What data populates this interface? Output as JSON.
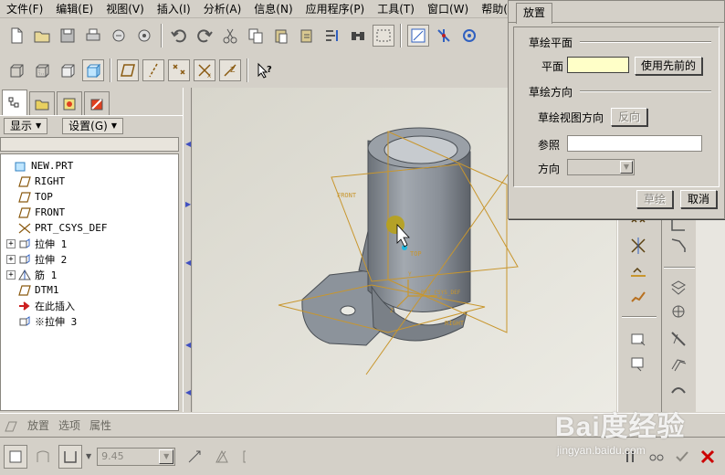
{
  "menubar": {
    "items": [
      "文件(F)",
      "编辑(E)",
      "视图(V)",
      "插入(I)",
      "分析(A)",
      "信息(N)",
      "应用程序(P)",
      "工具(T)",
      "窗口(W)",
      "帮助(H)"
    ]
  },
  "left_panel": {
    "show_label": "显示",
    "settings_label": "设置(G)"
  },
  "model_tree": {
    "items": [
      {
        "label": "NEW.PRT",
        "icon": "part-icon",
        "expand": ""
      },
      {
        "label": "RIGHT",
        "icon": "datum-plane-icon",
        "expand": ""
      },
      {
        "label": "TOP",
        "icon": "datum-plane-icon",
        "expand": ""
      },
      {
        "label": "FRONT",
        "icon": "datum-plane-icon",
        "expand": ""
      },
      {
        "label": "PRT_CSYS_DEF",
        "icon": "csys-icon",
        "expand": ""
      },
      {
        "label": "拉伸 1",
        "icon": "extrude-icon",
        "expand": "+"
      },
      {
        "label": "拉伸 2",
        "icon": "extrude-icon",
        "expand": "+"
      },
      {
        "label": "筋 1",
        "icon": "rib-icon",
        "expand": "+"
      },
      {
        "label": "DTM1",
        "icon": "datum-plane-icon",
        "expand": ""
      },
      {
        "label": "在此插入",
        "icon": "insert-here-icon",
        "expand": ""
      },
      {
        "label": "※拉伸 3",
        "icon": "extrude-icon",
        "expand": ""
      }
    ]
  },
  "viewport": {
    "labels": {
      "front": "FRONT",
      "top": "TOP",
      "csys": "PRT_CSYS_DEF",
      "right": "RIGHT",
      "x": "X",
      "y": "Y",
      "z": "Z"
    }
  },
  "dialog": {
    "tab_label": "放置",
    "sketch_plane_group": "草绘平面",
    "plane_label": "平面",
    "plane_value": "",
    "use_previous_button": "使用先前的",
    "sketch_orientation_group": "草绘方向",
    "view_direction_label": "草绘视图方向",
    "flip_button": "反向",
    "reference_label": "参照",
    "reference_value": "",
    "orientation_label": "方向",
    "orientation_value": "",
    "sketch_button": "草绘",
    "cancel_button": "取消"
  },
  "dashboard": {
    "tabs": [
      "放置",
      "选项",
      "属性"
    ],
    "depth_value": "9.45"
  },
  "watermark": {
    "brand": "Bai度经验",
    "url": "jingyan.baidu.com"
  },
  "colors": {
    "model_body": "#8c939b",
    "datum_frame": "#c8962d",
    "cancel_x": "#cc0000",
    "splitter_arrow": "#4050c0"
  }
}
